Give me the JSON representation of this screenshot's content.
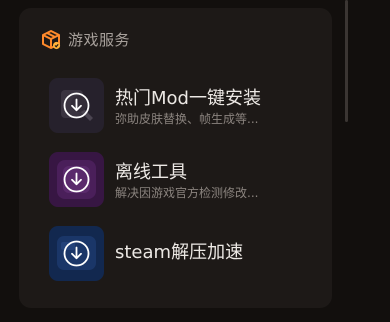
{
  "section": {
    "title": "游戏服务",
    "icon": "game-box-icon"
  },
  "items": [
    {
      "title": "热门Mod一键安装",
      "description": "弥助皮肤替换、帧生成等...",
      "icon": "download-icon",
      "tile_color": "#2a2430"
    },
    {
      "title": "离线工具",
      "description": "解决因游戏官方检测修改...",
      "icon": "download-icon",
      "tile_color": "#3a1748"
    },
    {
      "title": "steam解压加速",
      "icon": "download-icon",
      "tile_color": "#142b55"
    }
  ],
  "colors": {
    "background": "#120f0d",
    "panel": "#1d1917",
    "accent": "#ff8a2b"
  }
}
